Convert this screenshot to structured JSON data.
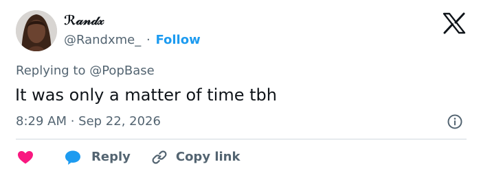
{
  "author": {
    "display_name": "ℛ𝒶𝓃𝒹𝓍",
    "handle": "@Randxme_",
    "separator": "·",
    "follow_label": "Follow"
  },
  "tweet": {
    "replying_prefix": "Replying to",
    "replying_to": "@PopBase",
    "text": "It was only a matter of time tbh",
    "timestamp": "8:29 AM · Sep 22, 2026"
  },
  "actions": {
    "reply_label": "Reply",
    "copy_link_label": "Copy link"
  },
  "colors": {
    "accent": "#1d9bf0",
    "like": "#f91880",
    "text_primary": "#0f1419",
    "text_secondary": "#536471",
    "divider": "#cfd9de"
  },
  "icons": {
    "brand": "x-logo-icon",
    "info": "info-icon",
    "like": "heart-icon",
    "reply": "speech-bubble-icon",
    "copy": "link-icon"
  }
}
